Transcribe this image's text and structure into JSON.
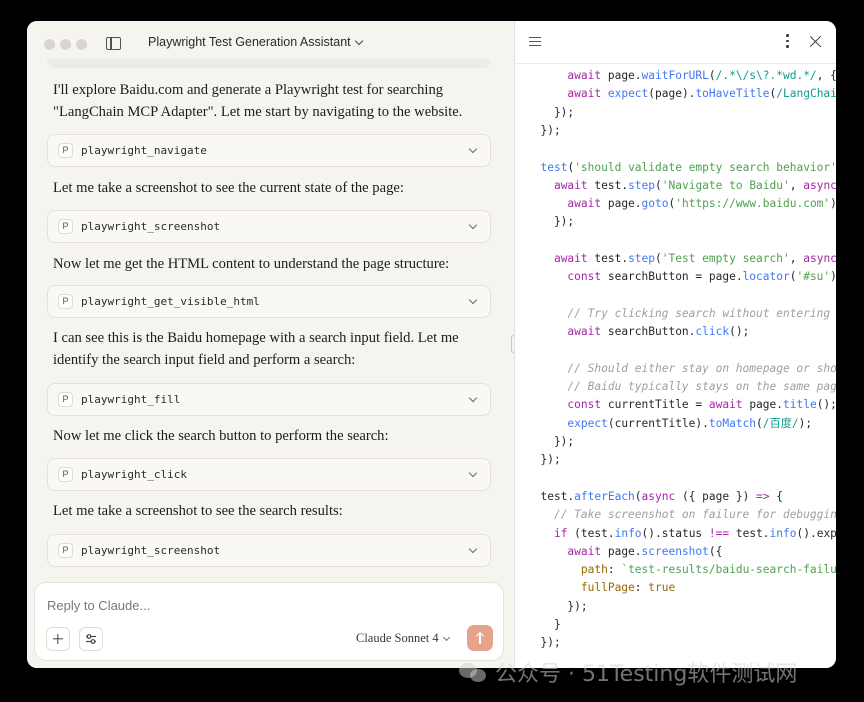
{
  "window": {
    "title": "Playwright Test Generation Assistant"
  },
  "chat": {
    "messages": [
      {
        "kind": "text",
        "text": "I'll explore Baidu.com and generate a Playwright test for searching \"LangChain MCP Adapter\". Let me start by navigating to the website."
      },
      {
        "kind": "tool",
        "badge": "P",
        "name": "playwright_navigate"
      },
      {
        "kind": "text",
        "text": "Let me take a screenshot to see the current state of the page:"
      },
      {
        "kind": "tool",
        "badge": "P",
        "name": "playwright_screenshot"
      },
      {
        "kind": "text",
        "text": "Now let me get the HTML content to understand the page structure:"
      },
      {
        "kind": "tool",
        "badge": "P",
        "name": "playwright_get_visible_html"
      },
      {
        "kind": "text",
        "text": "I can see this is the Baidu homepage with a search input field. Let me identify the search input field and perform a search:"
      },
      {
        "kind": "tool",
        "badge": "P",
        "name": "playwright_fill"
      },
      {
        "kind": "text",
        "text": "Now let me click the search button to perform the search:"
      },
      {
        "kind": "tool",
        "badge": "P",
        "name": "playwright_click"
      },
      {
        "kind": "text",
        "text": "Let me take a screenshot to see the search results:"
      },
      {
        "kind": "tool",
        "badge": "P",
        "name": "playwright_screenshot"
      }
    ]
  },
  "composer": {
    "placeholder": "Reply to Claude...",
    "model": "Claude Sonnet 4"
  },
  "icons": {
    "sidebar": "sidebar-toggle-icon",
    "add": "plus-icon",
    "tools": "sliders-icon",
    "send": "arrow-up-icon",
    "outline": "list-icon",
    "more": "kebab-icon",
    "close": "close-icon"
  },
  "colors": {
    "chat_bg": "#f5f4ee",
    "send_button": "#e6a48c",
    "code_bg": "#ffffff"
  },
  "code": {
    "lines": [
      [
        [
          "      ",
          ""
        ],
        [
          "await",
          "kw"
        ],
        [
          " page.",
          ""
        ],
        [
          "waitForURL",
          "fn"
        ],
        [
          "(",
          ""
        ],
        [
          "/.*\\/s\\?.*wd.*/",
          "re"
        ],
        [
          ", { t",
          ""
        ]
      ],
      [
        [
          "      ",
          ""
        ],
        [
          "await",
          "kw"
        ],
        [
          " ",
          ""
        ],
        [
          "expect",
          "fn"
        ],
        [
          "(page).",
          ""
        ],
        [
          "toHaveTitle",
          "fn"
        ],
        [
          "(",
          ""
        ],
        [
          "/LangChain",
          "re"
        ]
      ],
      [
        [
          "    });",
          ""
        ]
      ],
      [
        [
          "  });",
          ""
        ]
      ],
      [
        [
          "",
          ""
        ]
      ],
      [
        [
          "  ",
          ""
        ],
        [
          "test",
          "fn"
        ],
        [
          "(",
          ""
        ],
        [
          "'should validate empty search behavior'",
          "str"
        ],
        [
          ",",
          ""
        ]
      ],
      [
        [
          "    ",
          ""
        ],
        [
          "await",
          "kw"
        ],
        [
          " test.",
          ""
        ],
        [
          "step",
          "fn"
        ],
        [
          "(",
          ""
        ],
        [
          "'Navigate to Baidu'",
          "str"
        ],
        [
          ", ",
          ""
        ],
        [
          "async",
          "kw"
        ],
        [
          " (",
          ""
        ]
      ],
      [
        [
          "      ",
          ""
        ],
        [
          "await",
          "kw"
        ],
        [
          " page.",
          ""
        ],
        [
          "goto",
          "fn"
        ],
        [
          "(",
          ""
        ],
        [
          "'https://www.baidu.com'",
          "str"
        ],
        [
          ");",
          ""
        ]
      ],
      [
        [
          "    });",
          ""
        ]
      ],
      [
        [
          "",
          ""
        ]
      ],
      [
        [
          "    ",
          ""
        ],
        [
          "await",
          "kw"
        ],
        [
          " test.",
          ""
        ],
        [
          "step",
          "fn"
        ],
        [
          "(",
          ""
        ],
        [
          "'Test empty search'",
          "str"
        ],
        [
          ", ",
          ""
        ],
        [
          "async",
          "kw"
        ],
        [
          " (",
          ""
        ]
      ],
      [
        [
          "      ",
          ""
        ],
        [
          "const",
          "kw"
        ],
        [
          " searchButton = page.",
          ""
        ],
        [
          "locator",
          "fn"
        ],
        [
          "(",
          ""
        ],
        [
          "'#su'",
          "str"
        ],
        [
          ");",
          ""
        ]
      ],
      [
        [
          "",
          ""
        ]
      ],
      [
        [
          "      ",
          ""
        ],
        [
          "// Try clicking search without entering an",
          "cm"
        ]
      ],
      [
        [
          "      ",
          ""
        ],
        [
          "await",
          "kw"
        ],
        [
          " searchButton.",
          ""
        ],
        [
          "click",
          "fn"
        ],
        [
          "();",
          ""
        ]
      ],
      [
        [
          "",
          ""
        ]
      ],
      [
        [
          "      ",
          ""
        ],
        [
          "// Should either stay on homepage or show",
          "cm"
        ]
      ],
      [
        [
          "      ",
          ""
        ],
        [
          "// Baidu typically stays on the same page",
          "cm"
        ]
      ],
      [
        [
          "      ",
          ""
        ],
        [
          "const",
          "kw"
        ],
        [
          " currentTitle = ",
          ""
        ],
        [
          "await",
          "kw"
        ],
        [
          " page.",
          ""
        ],
        [
          "title",
          "fn"
        ],
        [
          "();",
          ""
        ]
      ],
      [
        [
          "      ",
          ""
        ],
        [
          "expect",
          "fn"
        ],
        [
          "(currentTitle).",
          ""
        ],
        [
          "toMatch",
          "fn"
        ],
        [
          "(",
          ""
        ],
        [
          "/百度/",
          "re"
        ],
        [
          ");",
          ""
        ]
      ],
      [
        [
          "    });",
          ""
        ]
      ],
      [
        [
          "  });",
          ""
        ]
      ],
      [
        [
          "",
          ""
        ]
      ],
      [
        [
          "  test.",
          ""
        ],
        [
          "afterEach",
          "fn"
        ],
        [
          "(",
          ""
        ],
        [
          "async",
          "kw"
        ],
        [
          " ({ page }) ",
          ""
        ],
        [
          "=>",
          "op"
        ],
        [
          " {",
          ""
        ]
      ],
      [
        [
          "    ",
          ""
        ],
        [
          "// Take screenshot on failure for debugging",
          "cm"
        ]
      ],
      [
        [
          "    ",
          ""
        ],
        [
          "if",
          "kw"
        ],
        [
          " (test.",
          ""
        ],
        [
          "info",
          "fn"
        ],
        [
          "().status ",
          ""
        ],
        [
          "!==",
          "op"
        ],
        [
          " test.",
          ""
        ],
        [
          "info",
          "fn"
        ],
        [
          "().expec",
          ""
        ]
      ],
      [
        [
          "      ",
          ""
        ],
        [
          "await",
          "kw"
        ],
        [
          " page.",
          ""
        ],
        [
          "screenshot",
          "fn"
        ],
        [
          "({",
          ""
        ]
      ],
      [
        [
          "        ",
          ""
        ],
        [
          "path",
          "pr"
        ],
        [
          ": ",
          ""
        ],
        [
          "`test-results/baidu-search-failure",
          "str"
        ]
      ],
      [
        [
          "        ",
          ""
        ],
        [
          "fullPage",
          "pr"
        ],
        [
          ": ",
          ""
        ],
        [
          "true",
          "bool"
        ]
      ],
      [
        [
          "      });",
          ""
        ]
      ],
      [
        [
          "    }",
          ""
        ]
      ],
      [
        [
          "  });",
          ""
        ]
      ]
    ]
  },
  "watermark": {
    "text": "公众号 · 51Testing软件测试网"
  }
}
